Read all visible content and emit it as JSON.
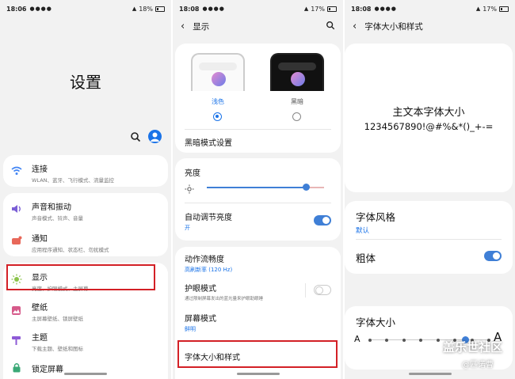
{
  "panel1": {
    "status": {
      "time": "18:06",
      "icons": "●●●●",
      "battery": "18%"
    },
    "title": "设置",
    "items": [
      {
        "title": "连接",
        "sub": "WLAN、蓝牙、飞行模式、流量监控",
        "icon": "wifi-icon",
        "color": "#4285f4"
      },
      {
        "title": "声音和振动",
        "sub": "声音模式、铃声、音量",
        "icon": "volume-icon",
        "color": "#7b5fd6"
      },
      {
        "title": "通知",
        "sub": "应用程序通知、状态栏、勿扰模式",
        "icon": "notification-icon",
        "color": "#e8685a"
      },
      {
        "title": "显示",
        "sub": "亮度、护眼模式、主屏幕",
        "icon": "display-sun-icon",
        "color": "#8bc34a"
      },
      {
        "title": "壁纸",
        "sub": "主屏幕壁纸、锁屏壁纸",
        "icon": "wallpaper-icon",
        "color": "#d65a8a"
      },
      {
        "title": "主题",
        "sub": "下载主题、壁纸和图标",
        "icon": "theme-icon",
        "color": "#8e5bd6"
      },
      {
        "title": "锁定屏幕",
        "sub": "",
        "icon": "lock-screen-icon",
        "color": "#3aa876"
      }
    ]
  },
  "panel2": {
    "status": {
      "time": "18:08",
      "icons": "●●●●",
      "battery": "17%"
    },
    "header": "显示",
    "theme_light": "浅色",
    "theme_dark": "黑暗",
    "dark_mode_settings": "黑暗模式设置",
    "brightness": "亮度",
    "brightness_level": 0.85,
    "auto_brightness": "自动调节亮度",
    "auto_brightness_state": "开",
    "motion_smoothness": "动作流畅度",
    "motion_smoothness_value": "高刷新率 (120 Hz)",
    "eye_comfort": "护眼模式",
    "eye_comfort_sub": "通过限制屏幕发出的蓝光量来护眼助眼睡",
    "screen_mode": "屏幕模式",
    "screen_mode_value": "鲜明",
    "font_size_style": "字体大小和样式"
  },
  "panel3": {
    "status": {
      "time": "18:08",
      "icons": "●●●●",
      "battery": "17%"
    },
    "header": "字体大小和样式",
    "preview_line1": "主文本字体大小",
    "preview_line2": "1234567890!@#%&*()_+-=",
    "font_style": "字体风格",
    "font_style_value": "默认",
    "bold": "粗体",
    "font_size": "字体大小",
    "font_size_small": "A",
    "font_size_large": "A",
    "font_size_level": 0.8,
    "watermark": "盖乐世社区",
    "watermark_user": "@匹诺曹"
  },
  "colors": {
    "accent": "#1a73e8",
    "toggle_on": "#3f7fd6",
    "highlight": "#d32026"
  }
}
